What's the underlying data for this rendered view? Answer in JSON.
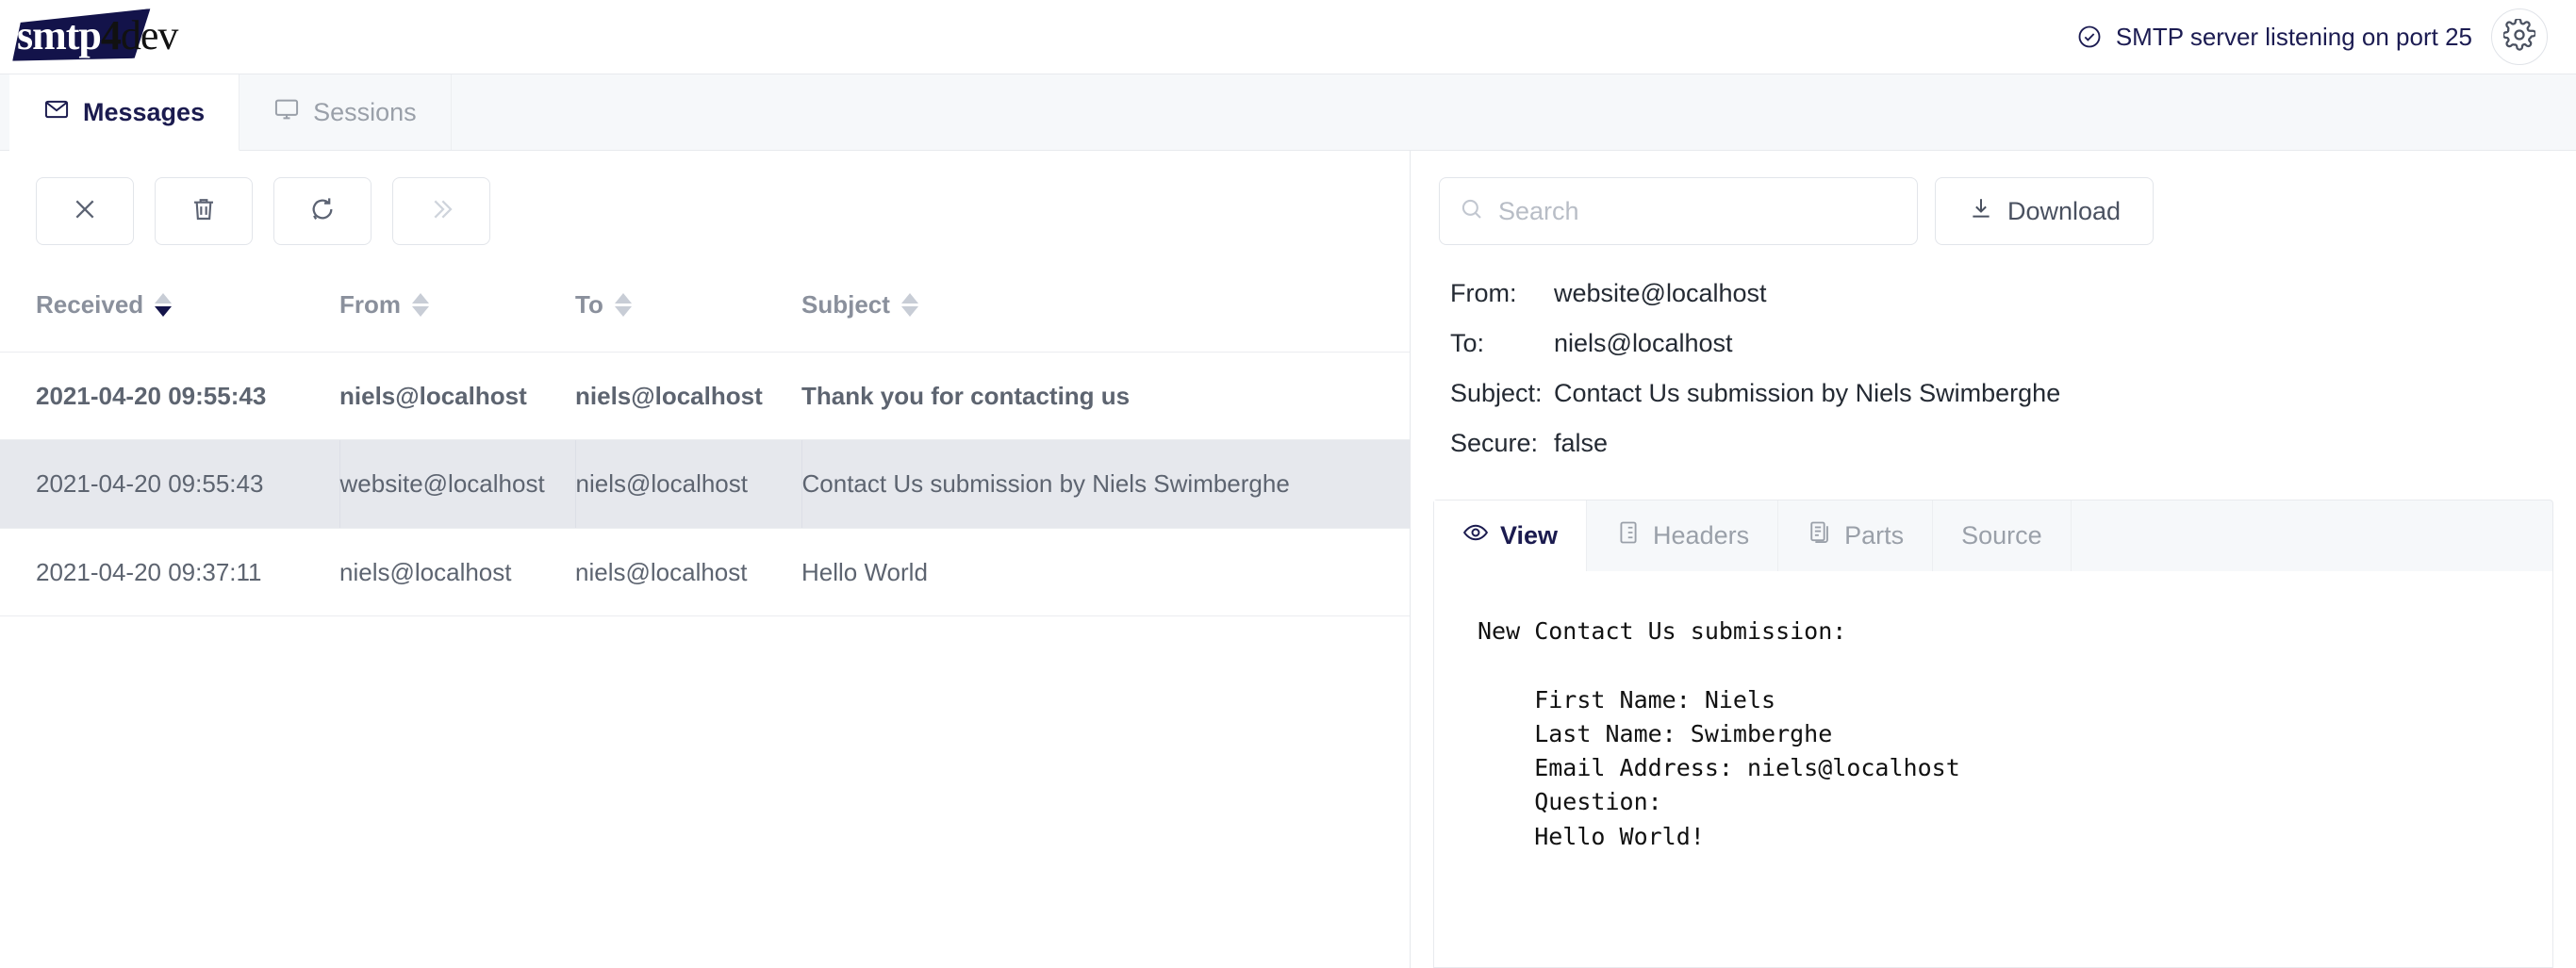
{
  "app": {
    "logo_smtp": "smtp",
    "logo_4": "4",
    "logo_dev": "dev",
    "status_text": "SMTP server listening on port 25",
    "status_icon": "check-circle-icon",
    "settings_icon": "gear-icon"
  },
  "tabs": [
    {
      "label": "Messages",
      "icon": "envelope-icon",
      "active": true
    },
    {
      "label": "Sessions",
      "icon": "monitor-icon",
      "active": false
    }
  ],
  "toolbar": {
    "buttons": [
      {
        "name": "clear-button",
        "icon": "close-icon",
        "disabled": false
      },
      {
        "name": "delete-button",
        "icon": "trash-icon",
        "disabled": false
      },
      {
        "name": "refresh-button",
        "icon": "refresh-icon",
        "disabled": false
      },
      {
        "name": "relay-button",
        "icon": "double-chevron-right-icon",
        "disabled": true
      }
    ],
    "search_placeholder": "Search",
    "search_value": "",
    "download_label": "Download",
    "download_icon": "download-icon"
  },
  "table": {
    "columns": [
      {
        "key": "received",
        "label": "Received",
        "sort": "desc"
      },
      {
        "key": "from",
        "label": "From",
        "sort": "none"
      },
      {
        "key": "to",
        "label": "To",
        "sort": "none"
      },
      {
        "key": "subject",
        "label": "Subject",
        "sort": "none"
      }
    ],
    "rows": [
      {
        "received": "2021-04-20 09:55:43",
        "from": "niels@localhost",
        "to": "niels@localhost",
        "subject": "Thank you for contacting us",
        "unread": true,
        "selected": false
      },
      {
        "received": "2021-04-20 09:55:43",
        "from": "website@localhost",
        "to": "niels@localhost",
        "subject": "Contact Us submission by Niels Swimberghe",
        "unread": false,
        "selected": true
      },
      {
        "received": "2021-04-20 09:37:11",
        "from": "niels@localhost",
        "to": "niels@localhost",
        "subject": "Hello World",
        "unread": false,
        "selected": false
      }
    ]
  },
  "detail": {
    "fields": [
      {
        "label": "From:",
        "value": "website@localhost"
      },
      {
        "label": "To:",
        "value": "niels@localhost"
      },
      {
        "label": "Subject:",
        "value": "Contact Us submission by Niels Swimberghe"
      },
      {
        "label": "Secure:",
        "value": "false"
      }
    ],
    "tabs": [
      {
        "label": "View",
        "icon": "eye-icon",
        "active": true
      },
      {
        "label": "Headers",
        "icon": "list-document-icon",
        "active": false
      },
      {
        "label": "Parts",
        "icon": "copy-document-icon",
        "active": false
      },
      {
        "label": "Source",
        "icon": "",
        "active": false
      }
    ],
    "body": "New Contact Us submission:\n\n    First Name: Niels\n    Last Name: Swimberghe\n    Email Address: niels@localhost\n    Question:\n    Hello World!"
  },
  "colors": {
    "brand_navy": "#13134a",
    "accent_text": "#1b1b4f",
    "muted": "#9aa0a9",
    "selected_row": "#e6e8ed",
    "border": "#e8eaee"
  }
}
